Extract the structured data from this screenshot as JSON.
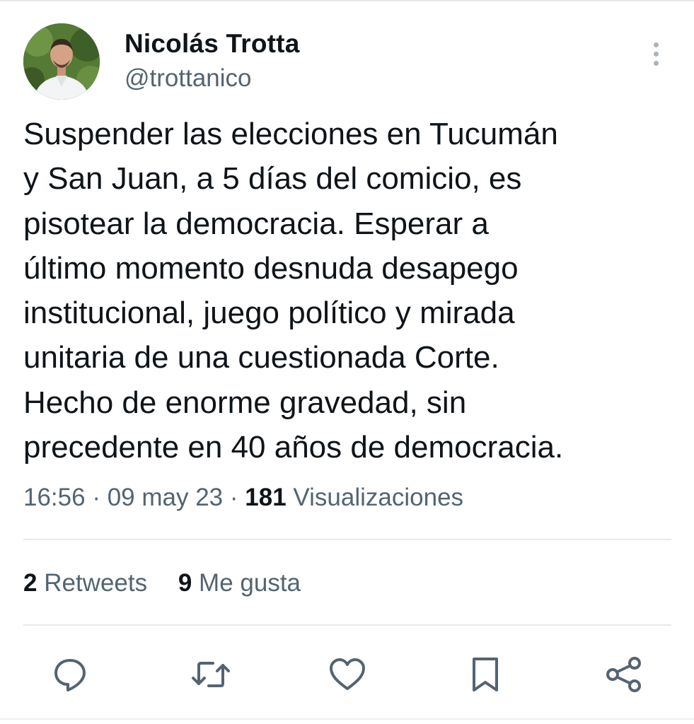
{
  "author": {
    "name": "Nicolás Trotta",
    "handle": "@trottanico"
  },
  "tweet": {
    "lines": [
      "Suspender las elecciones en Tucumán",
      "y San Juan, a 5 días del comicio, es",
      "pisotear la democracia. Esperar a",
      "último momento desnuda desapego",
      "institucional, juego político y mirada",
      "unitaria de una cuestionada Corte.",
      "Hecho de enorme gravedad, sin",
      "precedente en 40 años de democracia."
    ],
    "time": "16:56",
    "separator": "·",
    "date": "09 may 23",
    "views_count": "181",
    "views_label": "Visualizaciones"
  },
  "stats": {
    "retweets_count": "2",
    "retweets_label": "Retweets",
    "likes_count": "9",
    "likes_label": "Me gusta"
  },
  "icons": {
    "more": "more-vertical-icon",
    "reply": "reply-icon",
    "retweet": "retweet-icon",
    "like": "heart-icon",
    "bookmark": "bookmark-icon",
    "share": "share-icon"
  },
  "colors": {
    "text": "#0f1419",
    "secondary": "#536471",
    "divider": "#e6e9eb"
  }
}
